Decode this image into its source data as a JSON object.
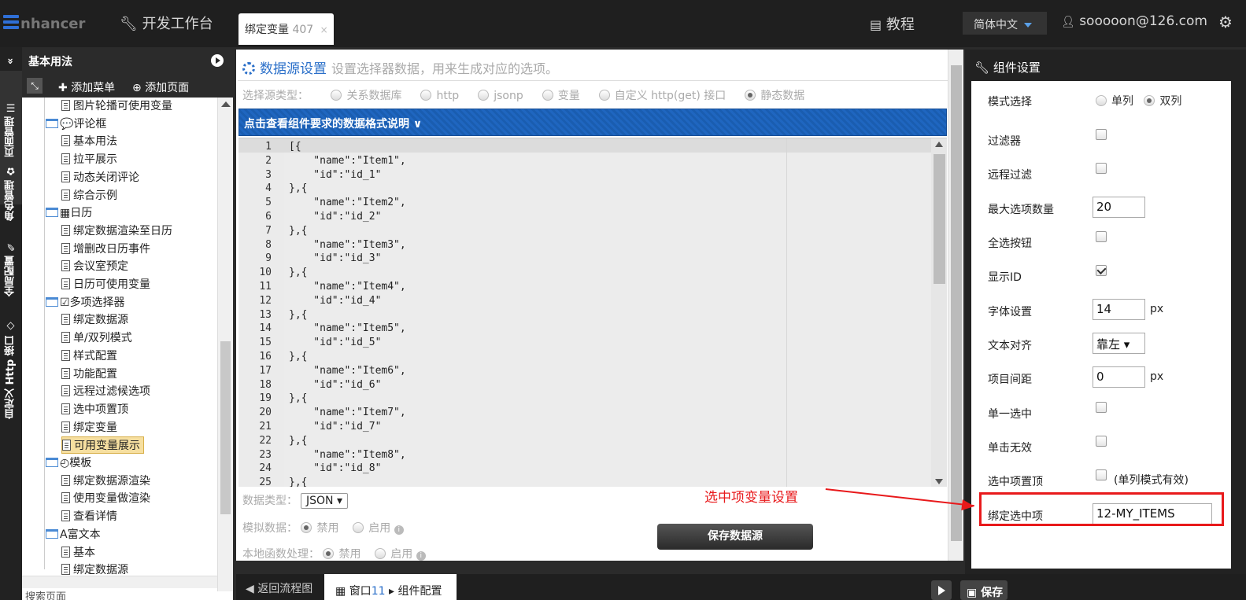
{
  "top": {
    "logo": "nhancer",
    "workbench": "开发工作台",
    "tab_label": "绑定变量",
    "tab_count": "407",
    "tab_close": "×",
    "tutorial": "教程",
    "language": "简体中文",
    "user": "sooooon@126.com"
  },
  "vtabs": [
    "页面管理",
    "角色管理",
    "全局配置",
    "自定义 Http 接口"
  ],
  "left": {
    "title": "基本用法",
    "collapse": "«",
    "add_menu": "添加菜单",
    "add_page": "添加页面",
    "search_placeholder": "搜索页面",
    "tree": [
      {
        "label": "图片轮播可使用变量",
        "type": "file",
        "level": 2
      },
      {
        "label": "评论框",
        "type": "folder",
        "level": 1,
        "glyph": "💬"
      },
      {
        "label": "基本用法",
        "type": "file",
        "level": 2
      },
      {
        "label": "拉平展示",
        "type": "file",
        "level": 2
      },
      {
        "label": "动态关闭评论",
        "type": "file",
        "level": 2
      },
      {
        "label": "综合示例",
        "type": "file",
        "level": 2
      },
      {
        "label": "日历",
        "type": "folder",
        "level": 1,
        "glyph": "▦"
      },
      {
        "label": "绑定数据渲染至日历",
        "type": "file",
        "level": 2
      },
      {
        "label": "增删改日历事件",
        "type": "file",
        "level": 2
      },
      {
        "label": "会议室预定",
        "type": "file",
        "level": 2
      },
      {
        "label": "日历可使用变量",
        "type": "file",
        "level": 2
      },
      {
        "label": "多项选择器",
        "type": "folder",
        "level": 1,
        "glyph": "☑"
      },
      {
        "label": "绑定数据源",
        "type": "file",
        "level": 2
      },
      {
        "label": "单/双列模式",
        "type": "file",
        "level": 2
      },
      {
        "label": "样式配置",
        "type": "file",
        "level": 2
      },
      {
        "label": "功能配置",
        "type": "file",
        "level": 2
      },
      {
        "label": "远程过滤候选项",
        "type": "file",
        "level": 2
      },
      {
        "label": "选中项置顶",
        "type": "file",
        "level": 2
      },
      {
        "label": "绑定变量",
        "type": "file",
        "level": 2
      },
      {
        "label": "可用变量展示",
        "type": "file",
        "level": 2,
        "selected": true
      },
      {
        "label": "模板",
        "type": "folder",
        "level": 1,
        "glyph": "◴"
      },
      {
        "label": "绑定数据源渲染",
        "type": "file",
        "level": 2
      },
      {
        "label": "使用变量做渲染",
        "type": "file",
        "level": 2
      },
      {
        "label": "查看详情",
        "type": "file",
        "level": 2
      },
      {
        "label": "富文本",
        "type": "folder",
        "level": 1,
        "glyph": "A"
      },
      {
        "label": "基本",
        "type": "file",
        "level": 2
      },
      {
        "label": "绑定数据源",
        "type": "file",
        "level": 2
      }
    ]
  },
  "main": {
    "title": "数据源设置",
    "subtitle": "设置选择器数据，用来生成对应的选项。",
    "source_type_label": "选择源类型：",
    "source_types": [
      {
        "label": "关系数据库",
        "checked": false
      },
      {
        "label": "http",
        "checked": false
      },
      {
        "label": "jsonp",
        "checked": false
      },
      {
        "label": "变量",
        "checked": false
      },
      {
        "label": "自定义 http(get) 接口",
        "checked": false
      },
      {
        "label": "静态数据",
        "checked": true
      }
    ],
    "format_bar": "点击查看组件要求的数据格式说明 ∨",
    "code_lines": [
      "[{",
      "    \"name\":\"Item1\",",
      "    \"id\":\"id_1\"",
      "},{",
      "    \"name\":\"Item2\",",
      "    \"id\":\"id_2\"",
      "},{",
      "    \"name\":\"Item3\",",
      "    \"id\":\"id_3\"",
      "},{",
      "    \"name\":\"Item4\",",
      "    \"id\":\"id_4\"",
      "},{",
      "    \"name\":\"Item5\",",
      "    \"id\":\"id_5\"",
      "},{",
      "    \"name\":\"Item6\",",
      "    \"id\":\"id_6\"",
      "},{",
      "    \"name\":\"Item7\",",
      "    \"id\":\"id_7\"",
      "},{",
      "    \"name\":\"Item8\",",
      "    \"id\":\"id_8\"",
      "},{"
    ],
    "data_type_label": "数据类型：",
    "data_type_value": "JSON ▾",
    "mock_label": "模拟数据：",
    "local_fn_label": "本地函数处理：",
    "disable": "禁用",
    "enable": "启用",
    "save_button": "保存数据源"
  },
  "right": {
    "title": "组件设置",
    "mode_label": "模式选择",
    "mode_single": "单列",
    "mode_double": "双列",
    "mode_selected": "双列",
    "rows": [
      {
        "label": "过滤器",
        "kind": "checkbox",
        "checked": false
      },
      {
        "label": "远程过滤",
        "kind": "checkbox",
        "checked": false
      },
      {
        "label": "最大选项数量",
        "kind": "input",
        "value": "20"
      },
      {
        "label": "全选按钮",
        "kind": "checkbox",
        "checked": false
      },
      {
        "label": "显示ID",
        "kind": "checkbox",
        "checked": true
      },
      {
        "label": "字体设置",
        "kind": "input",
        "value": "14",
        "unit": "px"
      },
      {
        "label": "文本对齐",
        "kind": "select",
        "value": "靠左 ▾"
      },
      {
        "label": "项目间距",
        "kind": "input",
        "value": "0",
        "unit": "px"
      },
      {
        "label": "单一选中",
        "kind": "checkbox",
        "checked": false
      },
      {
        "label": "单击无效",
        "kind": "checkbox",
        "checked": false
      },
      {
        "label": "选中项置顶",
        "kind": "checkbox",
        "checked": false,
        "note": "(单列模式有效)"
      },
      {
        "label": "绑定选中项",
        "kind": "input",
        "value": "12-MY_ITEMS"
      }
    ]
  },
  "annotation": {
    "text": "选中项变量设置",
    "color": "#e8191b"
  },
  "bottom": {
    "back": "返回流程图",
    "window_label": "窗口",
    "window_num": "11",
    "window_tab": "组件配置",
    "save": "保存"
  },
  "colors": {
    "accent": "#2a6fc9",
    "selected_tree": "#f6dfa0",
    "highlight": "#e8191b"
  }
}
